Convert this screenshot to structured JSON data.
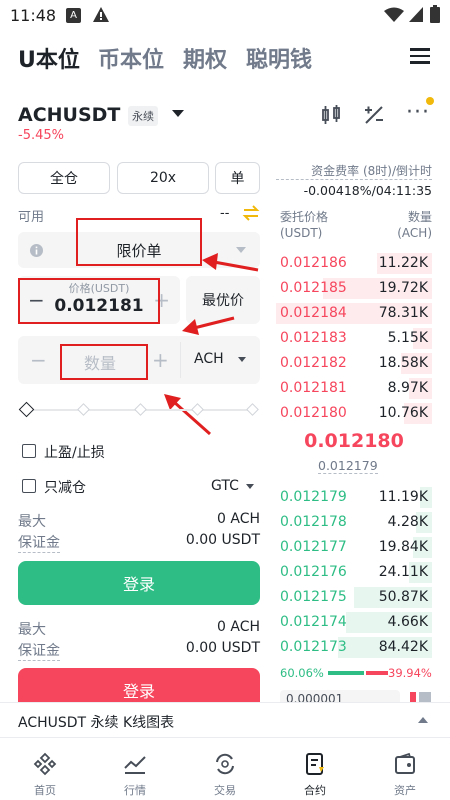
{
  "status_bar": {
    "time": "11:48",
    "icons": [
      "a-letter-icon",
      "warning-icon",
      "wifi-icon",
      "signal-icon",
      "battery-icon"
    ]
  },
  "top_tabs": [
    "U本位",
    "币本位",
    "期权",
    "聪明钱"
  ],
  "header": {
    "symbol": "ACHUSDT",
    "badge": "永续",
    "change": "-5.45%"
  },
  "controls": {
    "margin_mode": "全仓",
    "leverage": "20x",
    "position_mode": "单"
  },
  "available": {
    "label": "可用",
    "value": "--"
  },
  "order_type": "限价单",
  "price": {
    "label": "价格(USDT)",
    "value": "0.012181",
    "best_label": "最优价"
  },
  "quantity": {
    "placeholder": "数量",
    "unit": "ACH"
  },
  "tp_sl": "止盈/止损",
  "reduce_only": "只减仓",
  "tif": "GTC",
  "buy_block": {
    "max_label": "最大",
    "max_value": "0 ACH",
    "margin_label": "保证金",
    "margin_value": "0.00 USDT",
    "button": "登录"
  },
  "sell_block": {
    "max_label": "最大",
    "max_value": "0 ACH",
    "margin_label": "保证金",
    "margin_value": "0.00 USDT",
    "button": "登录"
  },
  "funding": {
    "label": "资金费率 (8时)/倒计时",
    "value": "-0.00418%/04:11:35"
  },
  "orderbook": {
    "col_price": "委托价格",
    "col_price_unit": "(USDT)",
    "col_qty": "数量",
    "col_qty_unit": "(ACH)",
    "asks": [
      {
        "price": "0.012186",
        "size": "11.22K",
        "depth": 0.35
      },
      {
        "price": "0.012185",
        "size": "19.72K",
        "depth": 0.7
      },
      {
        "price": "0.012184",
        "size": "78.31K",
        "depth": 1.0
      },
      {
        "price": "0.012183",
        "size": "5.15K",
        "depth": 0.12
      },
      {
        "price": "0.012182",
        "size": "18.58K",
        "depth": 0.2
      },
      {
        "price": "0.012181",
        "size": "8.97K",
        "depth": 0.15
      },
      {
        "price": "0.012180",
        "size": "10.76K",
        "depth": 0.18
      }
    ],
    "last_price": "0.012180",
    "mark_price": "0.012179",
    "bids": [
      {
        "price": "0.012179",
        "size": "11.19K",
        "depth": 0.08
      },
      {
        "price": "0.012178",
        "size": "4.28K",
        "depth": 0.1
      },
      {
        "price": "0.012177",
        "size": "19.84K",
        "depth": 0.12
      },
      {
        "price": "0.012176",
        "size": "24.11K",
        "depth": 0.15
      },
      {
        "price": "0.012175",
        "size": "50.87K",
        "depth": 0.5
      },
      {
        "price": "0.012174",
        "size": "4.66K",
        "depth": 0.55
      },
      {
        "price": "0.012173",
        "size": "84.42K",
        "depth": 0.6
      }
    ],
    "buy_ratio": "60.06%",
    "sell_ratio": "39.94%",
    "buy_fraction": 0.6006,
    "precision_partial": "0.000001"
  },
  "kline_bar": "ACHUSDT 永续 K线图表",
  "bottom_nav": [
    {
      "label": "首页",
      "icon": "binance-home-icon"
    },
    {
      "label": "行情",
      "icon": "market-chart-icon"
    },
    {
      "label": "交易",
      "icon": "trade-swap-icon"
    },
    {
      "label": "合约",
      "icon": "futures-icon"
    },
    {
      "label": "资产",
      "icon": "wallet-icon"
    }
  ],
  "colors": {
    "green": "#2ebd85",
    "red": "#f6465d",
    "annotation": "#e02020"
  }
}
